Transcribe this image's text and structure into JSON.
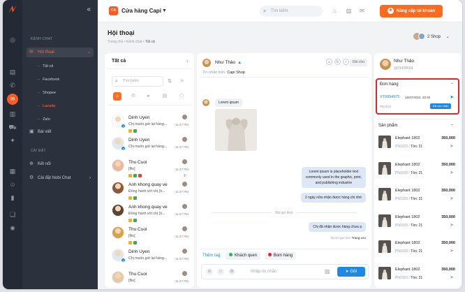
{
  "sidebar": {
    "group_chat": "KÊNH CHAT",
    "item_hoithoai": "Hội thoại",
    "sub": [
      "Tất cả",
      "Facebook",
      "Shopee",
      "Lazada",
      "Zalo"
    ],
    "item_baiviet": "Bài viết",
    "group_settings": "CÀI ĐẶT",
    "item_ketnoi": "Kết nối",
    "item_caidat": "Cài đặt Nobi Chat"
  },
  "header": {
    "shop_badge": "CA",
    "shop_name": "Cửa hàng Capi",
    "search_placeholder": "Tìm kiếm",
    "upgrade_label": "Nâng cấp tài khoản"
  },
  "page": {
    "title": "Hội thoại",
    "breadcrumb": [
      "Trang chủ",
      "Kênh chat",
      "Tất cả"
    ],
    "shop_count": "2 Shop"
  },
  "list": {
    "title": "Tất cả",
    "search_placeholder": "Tìm kiếm",
    "rows": [
      {
        "name": "Dinh Uyen",
        "preview": "Chị muốn gửi lại hàng...",
        "time": "11:47 PM",
        "badge": "2",
        "tags": [
          "#f0b41c",
          "#2eb35a"
        ]
      },
      {
        "name": "Dinh Uyen",
        "preview": "Chị muốn gửi lại hàng...",
        "time": "11:47 PM",
        "badge": "2",
        "tags": []
      },
      {
        "name": "Thu Cuoi",
        "preview": "[file]",
        "time": "11:47 PM",
        "badge": "",
        "tags": [
          "#f0b41c",
          "#2eb35a",
          "#d24a4a"
        ]
      },
      {
        "name": "Anh khong quay ve",
        "preview": "Đồng hành với chị (tr...",
        "time": "11:47 PM",
        "badge": "",
        "tags": [
          "#f0b41c",
          "#2eb35a"
        ]
      },
      {
        "name": "Anh khong quay ve",
        "preview": "Đồng hành với chị (tr...",
        "time": "11:47 PM",
        "badge": "",
        "tags": [
          "#f0b41c",
          "#2eb35a"
        ]
      },
      {
        "name": "Thu Cuoi",
        "preview": "[file]",
        "time": "11:47 PM",
        "badge": "",
        "tags": [
          "#f0b41c",
          "#2eb35a"
        ]
      },
      {
        "name": "Dinh Uyen",
        "preview": "Chị muốn gửi lại hàng...",
        "time": "11:47 PM",
        "badge": "2",
        "tags": []
      },
      {
        "name": "Thu Cuoi",
        "preview": "[file]",
        "time": "11:47 PM",
        "badge": "",
        "tags": []
      }
    ]
  },
  "chat": {
    "name": "Như Thảo",
    "from_label": "Tin nhắn trên:",
    "from_shop": "Capi Shop",
    "note_label": "Ghi chú",
    "msg_in": "Lorem ipsum",
    "msg_out1": [
      "Lorem ipsum is placeholder text",
      "commonly used in the graphic, print,",
      "and publishing industrie"
    ],
    "msg_out2": "2 ngày nữa nhận được hàng chị nhé",
    "divider": "Đã tạo đơn",
    "msg_out3": "Chị đã nhận được hàng chưa ạ",
    "sent_by_label": "Được gửi bởi:",
    "sent_by": "Trang Leu",
    "tag_label": "Thêm tag",
    "tags": [
      {
        "label": "Khách quen",
        "color": "#2eb35a"
      },
      {
        "label": "Bom hàng",
        "color": "#e0262a"
      }
    ],
    "input_placeholder": "Nhập tin nhắn",
    "send_label": "Gửi"
  },
  "customer": {
    "name": "Như Thảo",
    "id": "@01428694",
    "orders_title": "Đơn hàng",
    "order": {
      "code": "XT0834975",
      "date": "16/07/2023",
      "time": "20:40",
      "pn": "PN1023",
      "status": "Đã xác nhận"
    },
    "products_title": "Sản phẩm",
    "products": [
      {
        "name": "Elephant 1802",
        "price": "350,000",
        "sku": "PN1023",
        "stock_label": "Tồn:",
        "stock": "21"
      },
      {
        "name": "Elephant 1802",
        "price": "350,000",
        "sku": "PN1023",
        "stock_label": "Tồn:",
        "stock": "21"
      },
      {
        "name": "Elephant 1802",
        "price": "350,000",
        "sku": "PN1023",
        "stock_label": "Tồn:",
        "stock": "21"
      },
      {
        "name": "Elephant 1802",
        "price": "350,000",
        "sku": "PN1023",
        "stock_label": "Tồn:",
        "stock": "21"
      },
      {
        "name": "Elephant 1802",
        "price": "350,000",
        "sku": "PN1023",
        "stock_label": "Tồn:",
        "stock": "21"
      },
      {
        "name": "Elephant 1802",
        "price": "350,000",
        "sku": "PN1023",
        "stock_label": "Tồn:",
        "stock": "21"
      }
    ]
  },
  "colors": {
    "accent": "#ff6a1f",
    "primary": "#1e88e5",
    "sidebar": "#2b323e",
    "highlight": "#e0262a"
  }
}
